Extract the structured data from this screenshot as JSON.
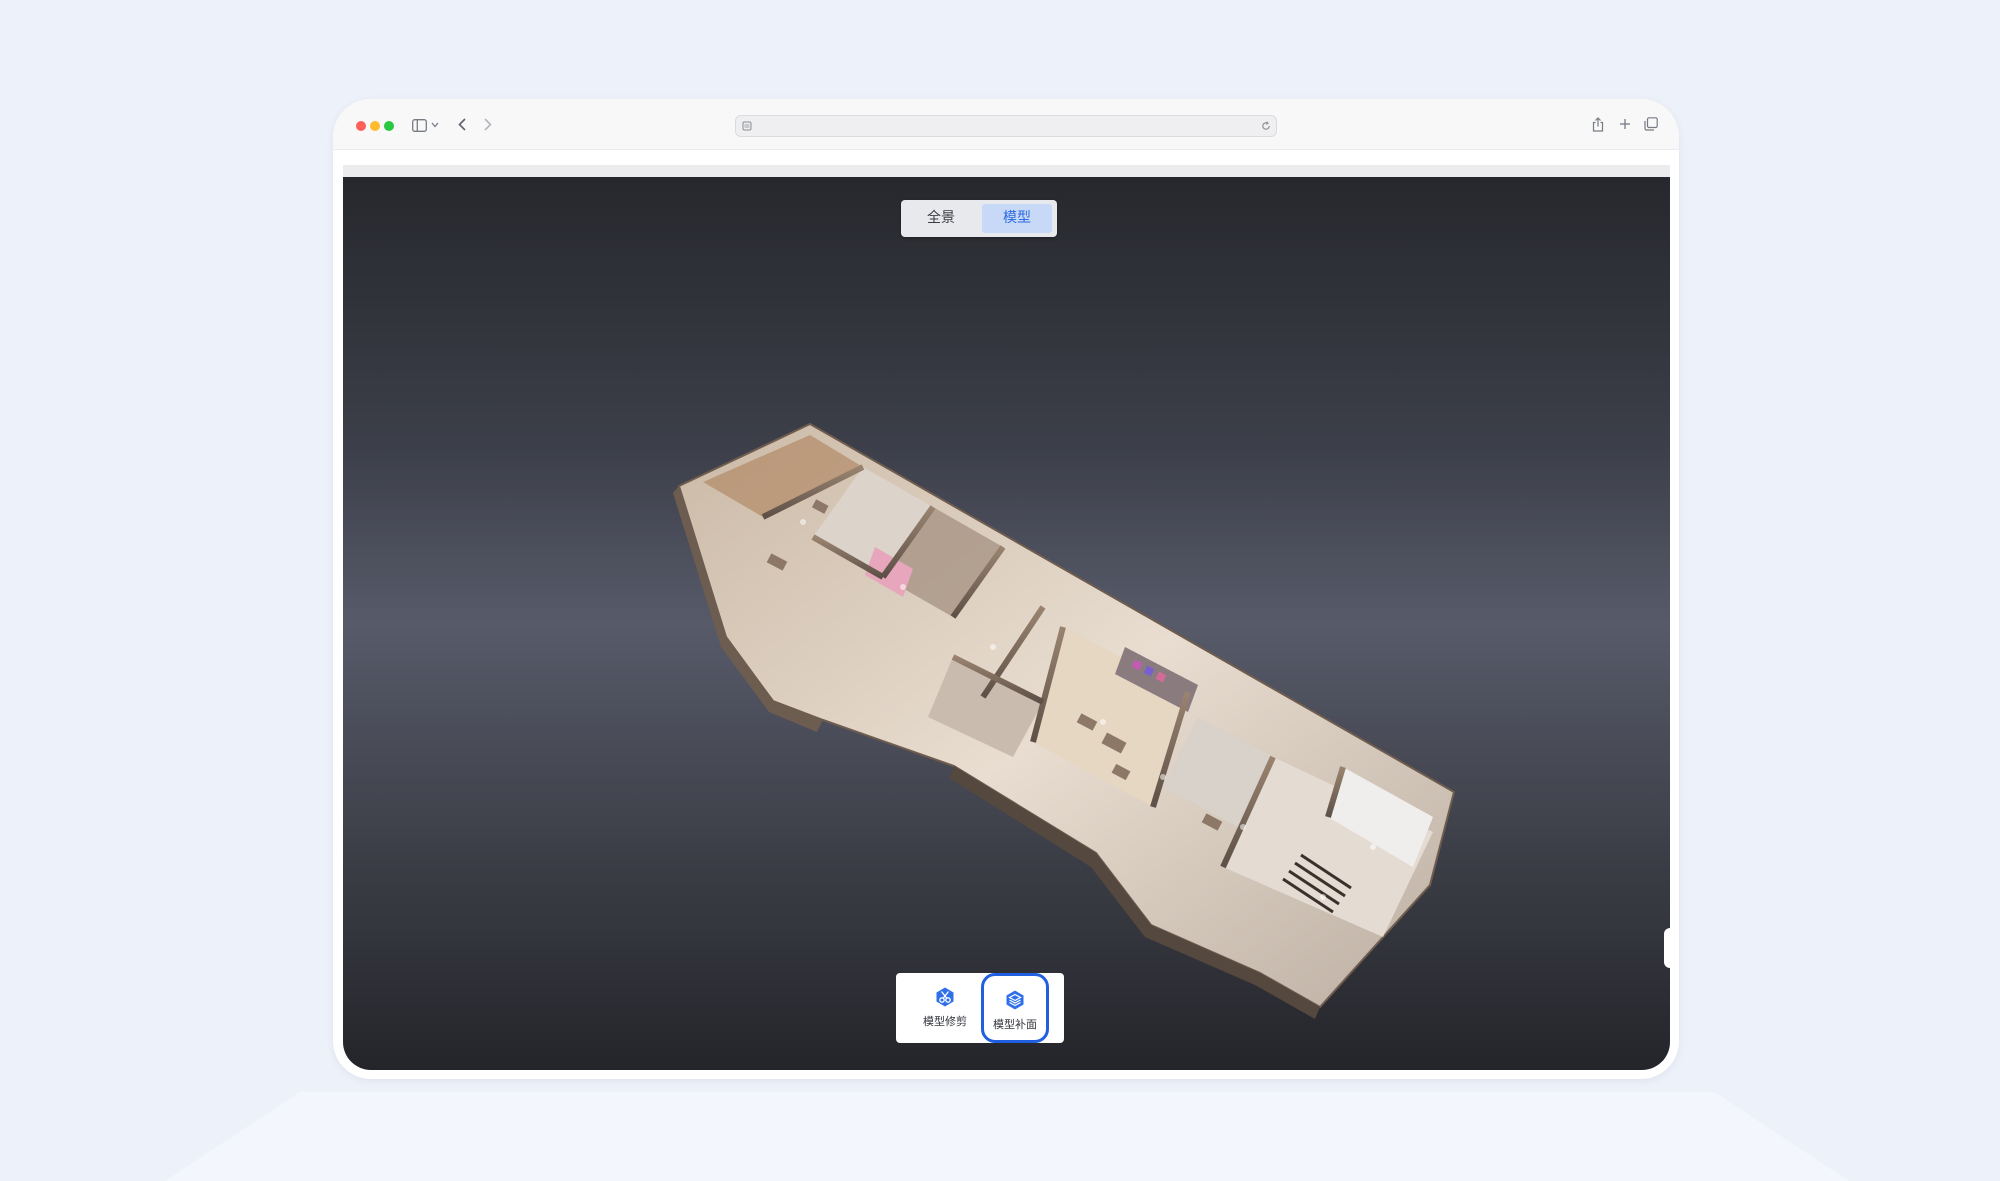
{
  "browser": {
    "traffic_lights": {
      "close": "#fe5f57",
      "minimize": "#febc2e",
      "zoom": "#28c840"
    },
    "icons": [
      "sidebar-icon",
      "chevron-down-icon",
      "back-icon",
      "forward-icon",
      "site-icon",
      "reload-icon",
      "share-icon",
      "new-tab-icon",
      "tabs-overview-icon"
    ]
  },
  "view_switch": {
    "panorama_label": "全景",
    "model_label": "模型",
    "active": "model"
  },
  "tools": {
    "trim_label": "模型修剪",
    "patch_label": "模型补面",
    "selected": "patch"
  },
  "colors": {
    "accent": "#1f5fe0",
    "active_segment_bg": "#c7d9f7",
    "active_segment_text": "#2d6ae0"
  }
}
